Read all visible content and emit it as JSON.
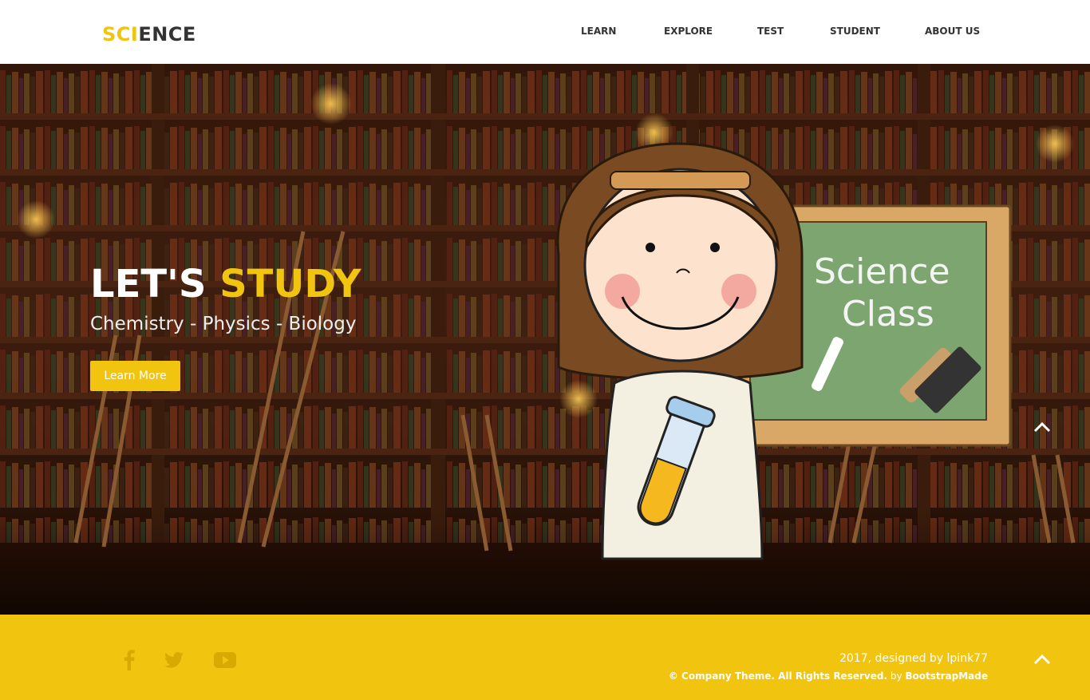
{
  "brand": {
    "accent": "SCI",
    "rest": "ENCE"
  },
  "nav": [
    {
      "label": "LEARN"
    },
    {
      "label": "EXPLORE"
    },
    {
      "label": "TEST"
    },
    {
      "label": "STUDENT"
    },
    {
      "label": "ABOUT US"
    }
  ],
  "hero": {
    "title_plain": "LET'S ",
    "title_highlight": "STUDY",
    "subtitle": "Chemistry - Physics - Biology",
    "button": "Learn More",
    "chalkboard_line1": "Science",
    "chalkboard_line2": "Class"
  },
  "footer": {
    "designed": "2017, designed by lpink77",
    "rights": "© Company Theme. All Rights Reserved.",
    "by": " by ",
    "maker": "BootstrapMade",
    "social": [
      "facebook-icon",
      "twitter-icon",
      "youtube-icon"
    ]
  },
  "colors": {
    "accent": "#f1c40f",
    "text_dark": "#333333",
    "white": "#ffffff"
  }
}
